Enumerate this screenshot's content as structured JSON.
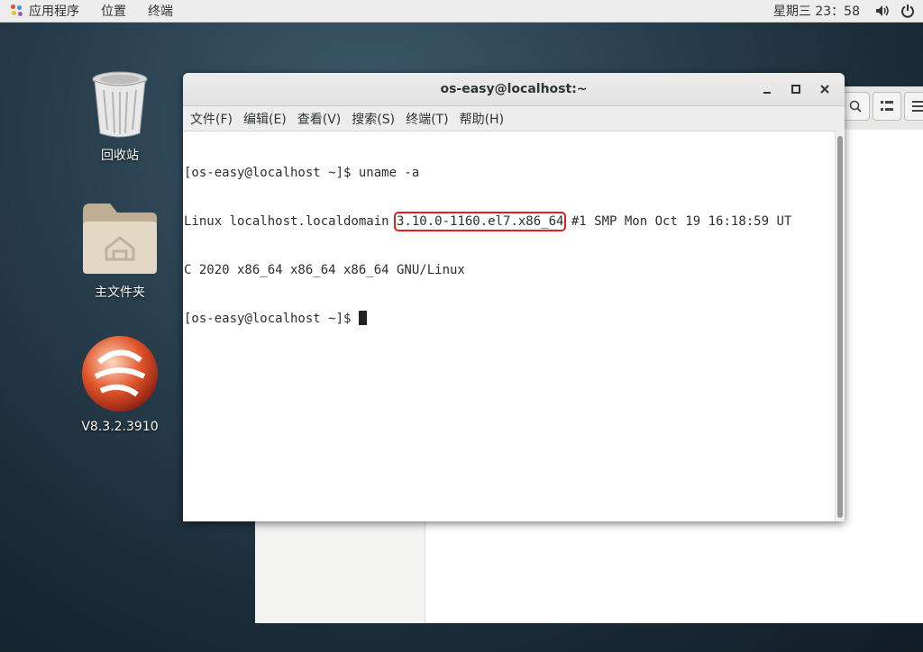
{
  "topbar": {
    "apps_label": "应用程序",
    "places_label": "位置",
    "terminal_label": "终端",
    "clock": "星期三 23：58",
    "volume_icon": "volume-icon",
    "power_icon": "power-icon"
  },
  "desktop": {
    "icons": [
      {
        "label": "回收站",
        "icon": "trash-icon"
      },
      {
        "label": "主文件夹",
        "icon": "home-folder-icon"
      },
      {
        "label": "V8.3.2.3910",
        "icon": "app-logo-icon"
      }
    ]
  },
  "terminal": {
    "title": "os-easy@localhost:~",
    "menu": [
      "文件(F)",
      "编辑(E)",
      "查看(V)",
      "搜索(S)",
      "终端(T)",
      "帮助(H)"
    ],
    "lines": {
      "cmd_prompt": "[os-easy@localhost ~]$ uname -a",
      "out1_pre": "Linux localhost.localdomain ",
      "out1_kernel": "3.10.0-1160.el7.x86_64",
      "out1_post": " #1 SMP Mon Oct 19 16:18:59 UT",
      "out2": "C 2020 x86_64 x86_64 x86_64 GNU/Linux",
      "prompt": "[os-easy@localhost ~]$ "
    },
    "highlight_color": "#e02020"
  }
}
